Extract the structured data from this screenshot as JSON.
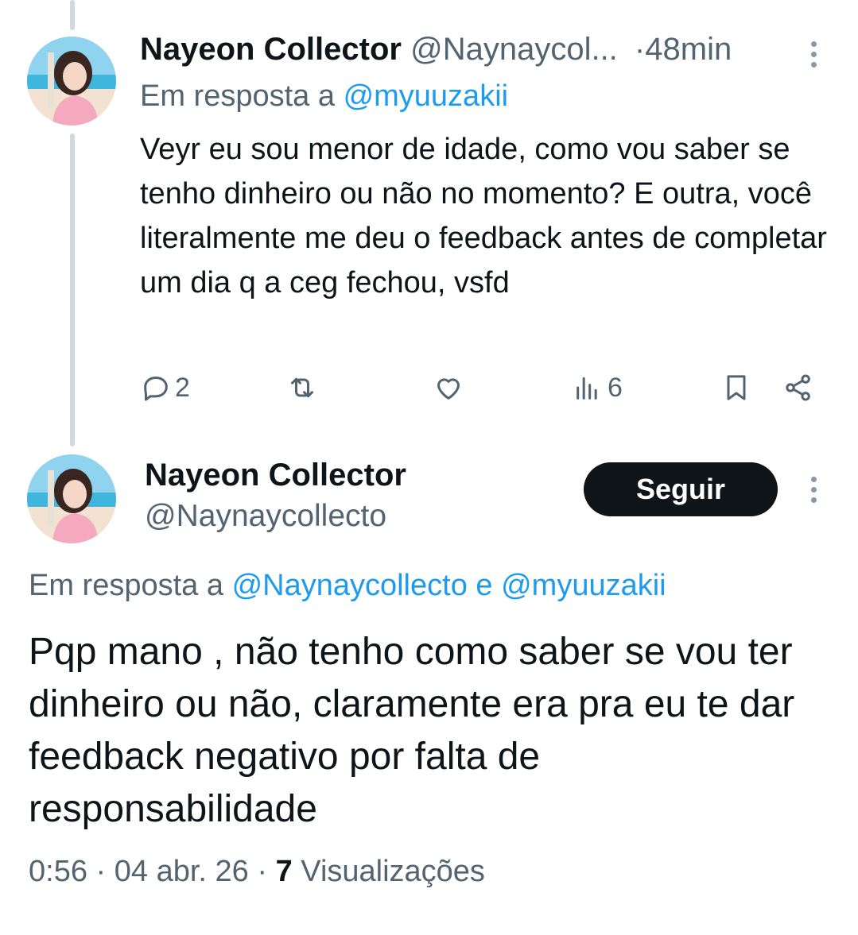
{
  "tweet1": {
    "author_name": "Nayeon Collector",
    "author_handle": "@Naynaycol...",
    "separator": "·",
    "time": "48min",
    "reply_prefix": "Em resposta a",
    "reply_to": "@myuuzakii",
    "text": "Veyr eu sou menor de idade, como vou saber se tenho dinheiro ou não no momento? E outra, você literalmente me deu o feedback antes de completar um dia q a ceg fechou, vsfd",
    "actions": {
      "replies": "2",
      "views": "6"
    }
  },
  "tweet2": {
    "author_name": "Nayeon Collector",
    "author_handle": "@Naynaycollecto",
    "follow_label": "Seguir",
    "reply_prefix": "Em resposta a",
    "reply_to_1": "@Naynaycollecto",
    "reply_and": "e",
    "reply_to_2": "@myuuzakii",
    "text": "Pqp mano , não tenho como saber se vou ter dinheiro ou não, claramente era pra eu te dar feedback negativo por falta de responsabilidade",
    "time": "0:56",
    "date": "04 abr. 26",
    "views_count": "7",
    "views_label": "Visualizações",
    "separator": "·"
  },
  "icons": [
    "reply-icon",
    "retweet-icon",
    "like-icon",
    "views-icon",
    "bookmark-icon",
    "share-icon",
    "more-icon"
  ],
  "colors": {
    "text": "#0f1419",
    "muted": "#536471",
    "link": "#1d9bf0",
    "thread_line": "#cfd9de",
    "follow_bg": "#0f1419"
  }
}
